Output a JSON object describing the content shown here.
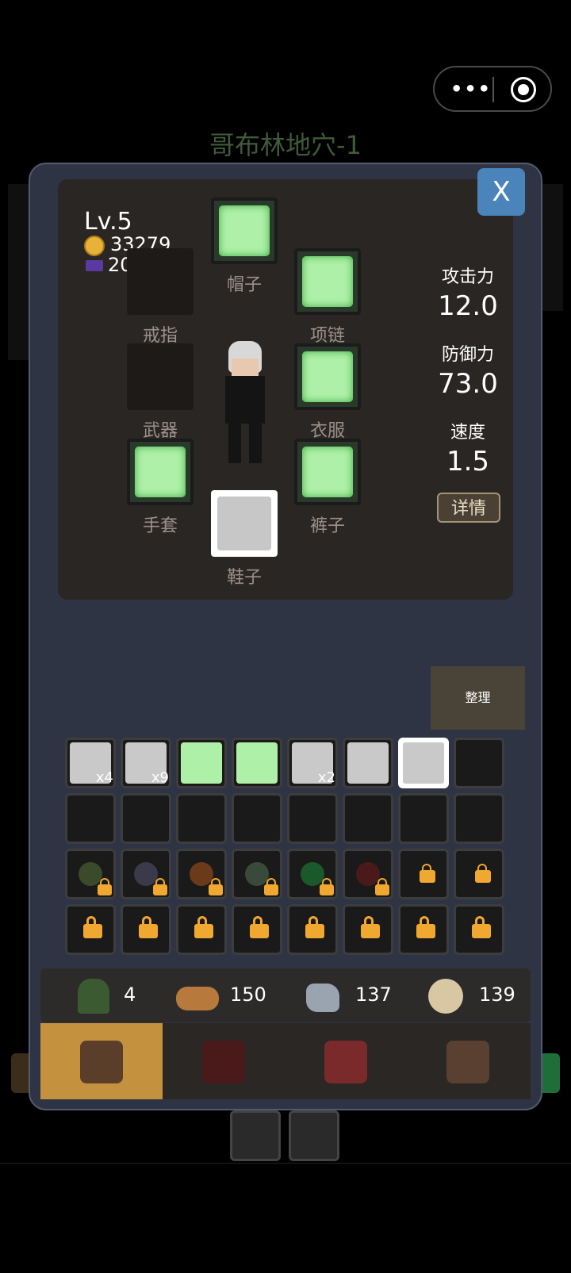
{
  "scene_title": "哥布林地穴-1",
  "player": {
    "level": "Lv.5",
    "gold": "33279",
    "gems": "20"
  },
  "close_label": "X",
  "slots": {
    "hat": "帽子",
    "ring": "戒指",
    "necklace": "项链",
    "weapon": "武器",
    "armor": "衣服",
    "gloves": "手套",
    "pants": "裤子",
    "shoes": "鞋子"
  },
  "stats": {
    "attack_label": "攻击力",
    "attack_value": "12.0",
    "defense_label": "防御力",
    "defense_value": "73.0",
    "speed_label": "速度",
    "speed_value": "1.5"
  },
  "detail_label": "详情",
  "sort_label": "整理",
  "inventory_qty": {
    "potion_red": "x4",
    "cloth": "x9",
    "crystal": "x2"
  },
  "resources": {
    "herb": "4",
    "wood": "150",
    "ore": "137",
    "thread": "139"
  },
  "tabs": [
    "backpack",
    "skills",
    "book",
    "monsters"
  ],
  "colors": {
    "active_tab": "#c4923f",
    "close_button": "#4a84ba",
    "rare_slot": "#aef0a8"
  }
}
